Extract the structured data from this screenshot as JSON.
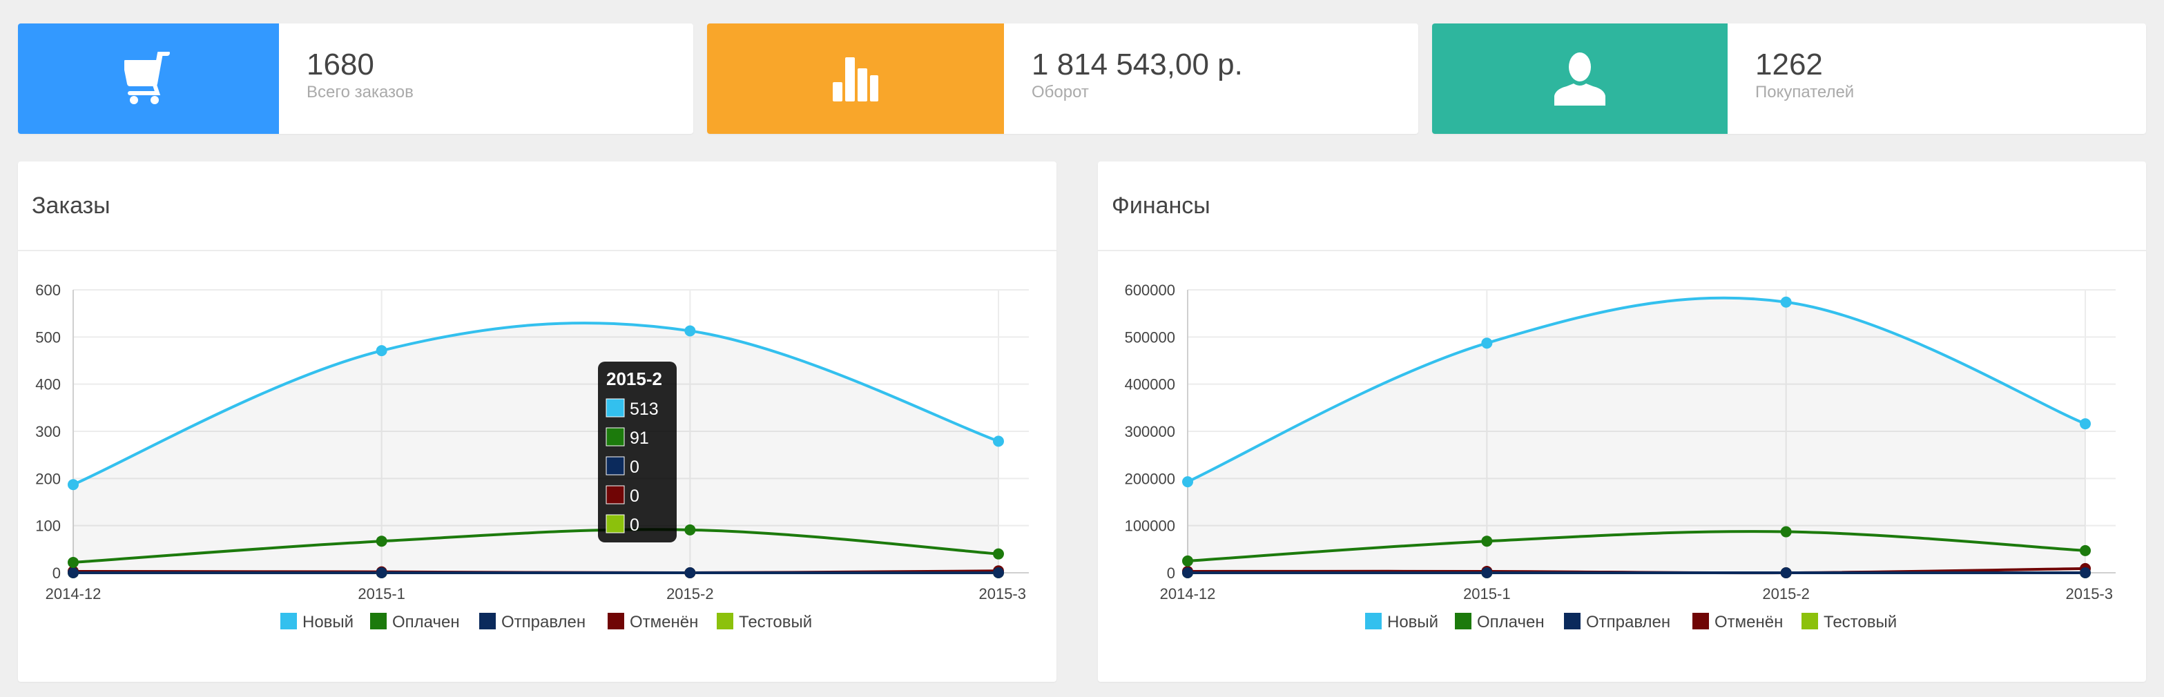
{
  "stats": [
    {
      "value": "1680",
      "label": "Всего заказов",
      "color": "#3399ff",
      "icon": "cart-icon"
    },
    {
      "value": "1 814 543,00 р.",
      "label": "Оборот",
      "color": "#f9a62a",
      "icon": "bar-chart-icon"
    },
    {
      "value": "1262",
      "label": "Покупателей",
      "color": "#2eb69e",
      "icon": "user-icon"
    }
  ],
  "panels": {
    "orders": {
      "title": "Заказы"
    },
    "finance": {
      "title": "Финансы"
    }
  },
  "legend": [
    {
      "name": "Новый",
      "color": "#33c0ee"
    },
    {
      "name": "Оплачен",
      "color": "#1c7a0c"
    },
    {
      "name": "Отправлен",
      "color": "#0b2a5c"
    },
    {
      "name": "Отменён",
      "color": "#700505"
    },
    {
      "name": "Тестовый",
      "color": "#8cc10c"
    }
  ],
  "chart_data": [
    {
      "type": "line",
      "title": "Заказы",
      "categories": [
        "2014-12",
        "2015-1",
        "2015-2",
        "2015-3"
      ],
      "ylim": [
        0,
        600
      ],
      "yticks": [
        0,
        100,
        200,
        300,
        400,
        500,
        600
      ],
      "yticks_text": [
        "0",
        "100",
        "200",
        "300",
        "400",
        "500",
        "600"
      ],
      "grid": true,
      "legend_position": "bottom",
      "series": [
        {
          "name": "Новый",
          "color": "#33c0ee",
          "values": [
            187,
            471,
            513,
            279
          ]
        },
        {
          "name": "Оплачен",
          "color": "#1c7a0c",
          "values": [
            22,
            67,
            91,
            40
          ]
        },
        {
          "name": "Отправлен",
          "color": "#0b2a5c",
          "values": [
            0,
            0,
            0,
            0
          ]
        },
        {
          "name": "Отменён",
          "color": "#700505",
          "values": [
            3,
            2,
            0,
            4
          ]
        },
        {
          "name": "Тестовый",
          "color": "#8cc10c",
          "values": [
            0,
            0,
            0,
            0
          ]
        }
      ],
      "tooltip": {
        "category": "2015-2",
        "values": [
          "513",
          "91",
          "0",
          "0",
          "0"
        ]
      }
    },
    {
      "type": "line",
      "title": "Финансы",
      "categories": [
        "2014-12",
        "2015-1",
        "2015-2",
        "2015-3"
      ],
      "ylim": [
        0,
        600000
      ],
      "yticks": [
        0,
        100000,
        200000,
        300000,
        400000,
        500000,
        600000
      ],
      "yticks_text": [
        "0",
        "100000",
        "200000",
        "300000",
        "400000",
        "500000",
        "600000"
      ],
      "grid": true,
      "legend_position": "bottom",
      "series": [
        {
          "name": "Новый",
          "color": "#33c0ee",
          "values": [
            193000,
            487000,
            574000,
            316000
          ]
        },
        {
          "name": "Оплачен",
          "color": "#1c7a0c",
          "values": [
            25000,
            67000,
            87000,
            47000
          ]
        },
        {
          "name": "Отправлен",
          "color": "#0b2a5c",
          "values": [
            0,
            0,
            0,
            0
          ]
        },
        {
          "name": "Отменён",
          "color": "#700505",
          "values": [
            3000,
            3000,
            0,
            9000
          ]
        },
        {
          "name": "Тестовый",
          "color": "#8cc10c",
          "values": [
            0,
            0,
            0,
            0
          ]
        }
      ]
    }
  ]
}
